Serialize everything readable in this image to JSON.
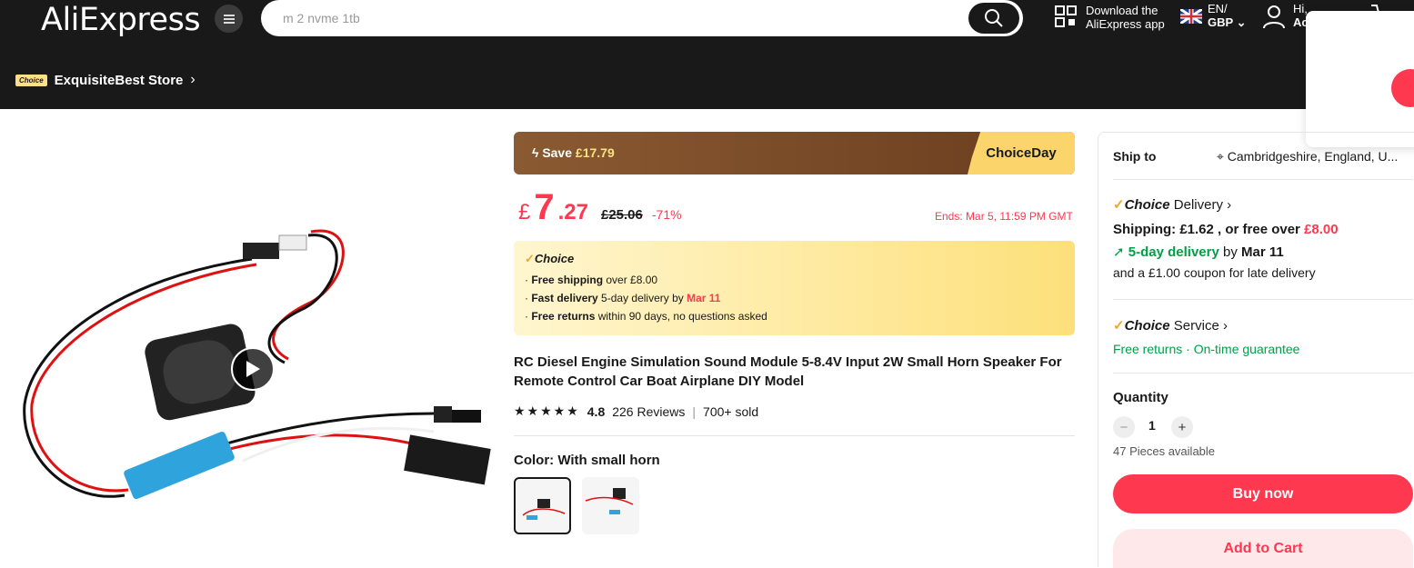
{
  "header": {
    "logo": "AliExpress",
    "search_placeholder": "m 2 nvme 1tb",
    "download_line1": "Download the",
    "download_line2": "AliExpress app",
    "lang": "EN/",
    "currency": "GBP",
    "hi": "Hi,",
    "account_short": "Ac"
  },
  "store": {
    "badge": "Choice",
    "name": "ExquisiteBest Store"
  },
  "product": {
    "save_label": "Save",
    "save_amount": "£17.79",
    "choice_day": "ChoiceDay",
    "currency_symbol": "£",
    "price_int": "7",
    "price_dec": ".27",
    "price_old": "£25.06",
    "discount": "-71%",
    "ends": "Ends: Mar 5, 11:59 PM GMT",
    "choice_title": "Choice",
    "choice_lines": [
      {
        "bold": "Free shipping",
        "text": " over £8.00",
        "extra": ""
      },
      {
        "bold": "Fast delivery",
        "text": " 5-day delivery by ",
        "extra": "Mar 11"
      },
      {
        "bold": "Free returns",
        "text": "  within 90 days, no questions asked",
        "extra": ""
      }
    ],
    "title": "RC Diesel Engine Simulation Sound Module 5-8.4V Input 2W Small Horn Speaker For Remote Control Car Boat Airplane DIY Model",
    "stars": "★★★★★",
    "rating": "4.8",
    "reviews": "226 Reviews",
    "sold": "700+ sold",
    "color_label": "Color: With small horn"
  },
  "side": {
    "ship_to_label": "Ship to",
    "ship_to_value": "Cambridgeshire, England, U...",
    "choice_delivery": "Delivery",
    "shipping": "Shipping: £1.62 , or free over ",
    "shipping_free_amount": "£8.00",
    "delivery_days": "5-day delivery",
    "delivery_by": " by ",
    "delivery_date": "Mar 11",
    "coupon": "and a £1.00 coupon for late delivery",
    "choice_service": "Service",
    "service_free_returns": "Free returns",
    "service_sep": " · ",
    "service_ontime": "On-time guarantee",
    "quantity_label": "Quantity",
    "quantity_value": "1",
    "available": "47 Pieces available",
    "buy_now": "Buy now",
    "add_to_cart": "Add to Cart"
  }
}
